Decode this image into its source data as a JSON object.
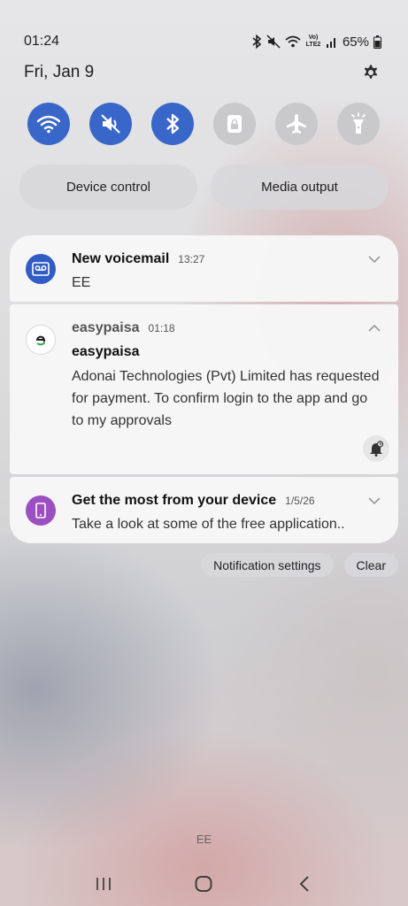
{
  "status_bar": {
    "time": "01:24",
    "battery_percent": "65%",
    "network_label": "Vo) LTE2",
    "icons": [
      "bluetooth-icon",
      "mute-icon",
      "wifi-calling-icon",
      "signal-icon",
      "battery-icon"
    ]
  },
  "header": {
    "date": "Fri, Jan 9",
    "settings_icon": "gear-icon"
  },
  "quick_settings": [
    {
      "name": "wifi",
      "icon": "wifi-icon",
      "active": true
    },
    {
      "name": "sound",
      "icon": "mute-icon",
      "active": true
    },
    {
      "name": "bluetooth",
      "icon": "bluetooth-icon",
      "active": true
    },
    {
      "name": "portrait-lock",
      "icon": "lock-icon",
      "active": false
    },
    {
      "name": "airplane-mode",
      "icon": "airplane-icon",
      "active": false
    },
    {
      "name": "flashlight",
      "icon": "flashlight-icon",
      "active": false
    }
  ],
  "pills": {
    "device_control": "Device control",
    "media_output": "Media output"
  },
  "notifications": {
    "voicemail": {
      "title": "New voicemail",
      "time": "13:27",
      "body": "EE"
    },
    "easypaisa": {
      "app": "easypaisa",
      "time": "01:18",
      "title": "easypaisa",
      "body": "Adonai Technologies (Pvt) Limited  has requested for payment. To confirm login to the app and go to my approvals"
    },
    "device": {
      "title": "Get the most from your device",
      "time": "1/5/26",
      "body": "Take a look at some of the free application.."
    }
  },
  "actions": {
    "notification_settings": "Notification settings",
    "clear": "Clear"
  },
  "carrier": "EE",
  "colors": {
    "accent": "#3967c9",
    "inactive_toggle": "#c9c9cc",
    "voicemail_icon_bg": "#2f5cc5",
    "device_icon_bg": "#9c4fc0",
    "easypaisa_green": "#2aa84a"
  }
}
